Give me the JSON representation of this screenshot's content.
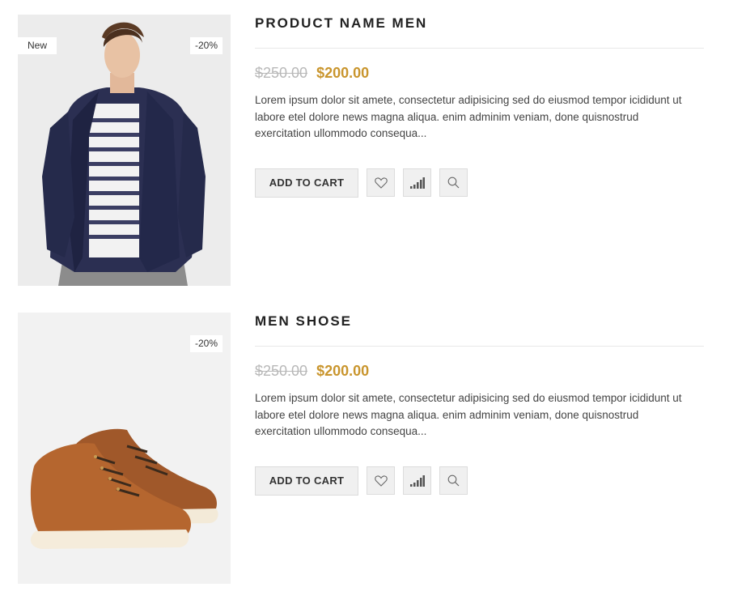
{
  "products": [
    {
      "title": "PRODUCT NAME MEN",
      "badge_new": "New",
      "badge_sale": "-20%",
      "old_price": "$250.00",
      "new_price": "$200.00",
      "description": "Lorem ipsum dolor sit amete, consectetur adipisicing sed do eiusmod tempor icididunt ut labore etel dolore news magna aliqua. enim adminim veniam, done quisnostrud exercitation ullommodo consequa...",
      "add_to_cart": "ADD TO CART",
      "image": "man-in-navy-jacket-photo",
      "icons": [
        "heart-icon",
        "compare-icon",
        "search-icon"
      ]
    },
    {
      "title": "MEN SHOSE",
      "badge_sale": "-20%",
      "old_price": "$250.00",
      "new_price": "$200.00",
      "description": "Lorem ipsum dolor sit amete, consectetur adipisicing sed do eiusmod tempor icididunt ut labore etel dolore news magna aliqua. enim adminim veniam, done quisnostrud exercitation ullommodo consequa...",
      "add_to_cart": "ADD TO CART",
      "image": "brown-leather-sneakers-photo",
      "icons": [
        "heart-icon",
        "compare-icon",
        "search-icon"
      ]
    }
  ],
  "colors": {
    "accent_price": "#c9952d",
    "old_price": "#b8b8b8",
    "button_bg": "#f0f0f0"
  }
}
